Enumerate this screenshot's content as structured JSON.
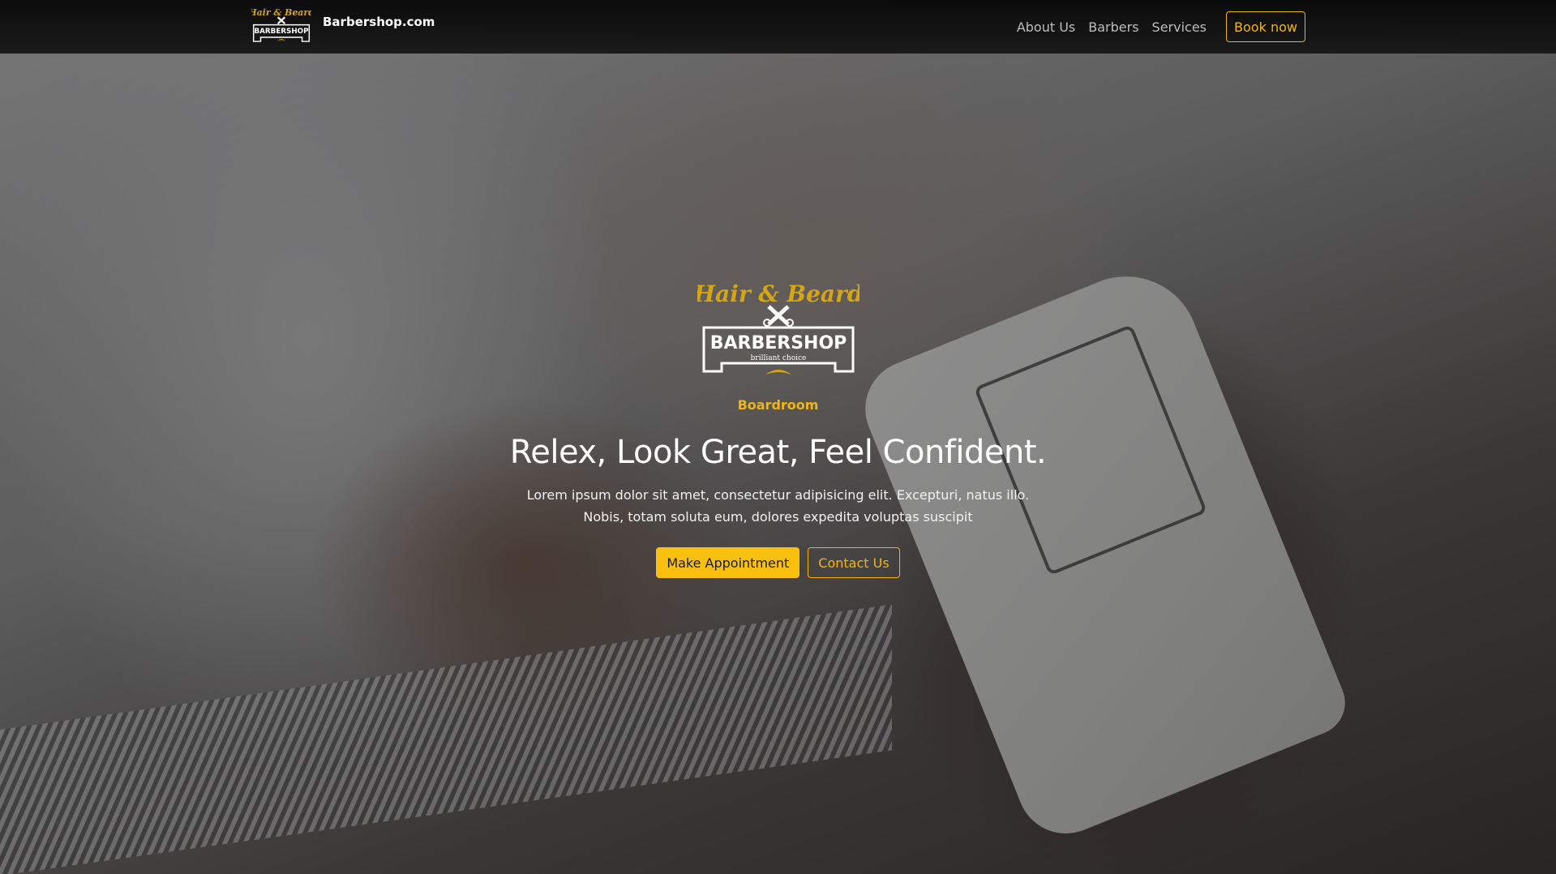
{
  "navbar": {
    "brand_name": "Barbershop.com",
    "logo_icon": "barbershop-logo-icon",
    "links": [
      "About Us",
      "Barbers",
      "Services"
    ],
    "book_label": "Book now"
  },
  "logo": {
    "script_text": "Hair & Beard",
    "main_text": "BARBERSHOP",
    "tagline": "brilliant choice"
  },
  "hero": {
    "eyebrow": "Boardroom",
    "title": "Relex, Look Great, Feel Confident.",
    "description": "Lorem ipsum dolor sit amet, consectetur adipisicing elit. Excepturi, natus illo. Nobis, totam soluta eum, dolores expedita voluptas suscipit",
    "primary_button": "Make Appointment",
    "secondary_button": "Contact Us"
  },
  "colors": {
    "accent": "#f0b512",
    "primary_button_bg": "#f9c010",
    "navbar_bg": "#0d0d0d",
    "text_light": "#ffffff"
  }
}
